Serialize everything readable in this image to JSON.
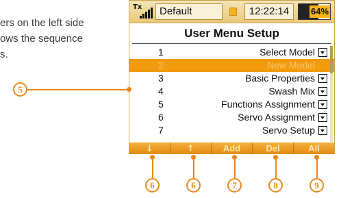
{
  "side_text": {
    "lines": [
      "ers on the left side",
      "ows the sequence",
      "s."
    ]
  },
  "status_bar": {
    "tx_label": "Tx",
    "model_name": "Default",
    "time": "12:22:14",
    "battery": "64%",
    "battery_level": 0.64
  },
  "menu": {
    "title": "User Menu Setup",
    "rows": [
      {
        "num": "1",
        "label": "Select Model"
      },
      {
        "num": "2",
        "label": "New Model"
      },
      {
        "num": "3",
        "label": "Basic Properties"
      },
      {
        "num": "4",
        "label": "Swash Mix"
      },
      {
        "num": "5",
        "label": "Functions Assignment"
      },
      {
        "num": "6",
        "label": "Servo Assignment"
      },
      {
        "num": "7",
        "label": "Servo Setup"
      }
    ],
    "selected_index": 1
  },
  "softkeys": {
    "down": "↓",
    "up": "↑",
    "add": "Add",
    "del": "Del",
    "all": "All"
  },
  "callouts": {
    "c5": "5",
    "c6a": "6",
    "c6b": "6",
    "c7": "7",
    "c8": "8",
    "c9": "9"
  },
  "colors": {
    "accent": "#e8891a",
    "selection": "#f29b0f",
    "status_bar": "#e8c97a"
  }
}
